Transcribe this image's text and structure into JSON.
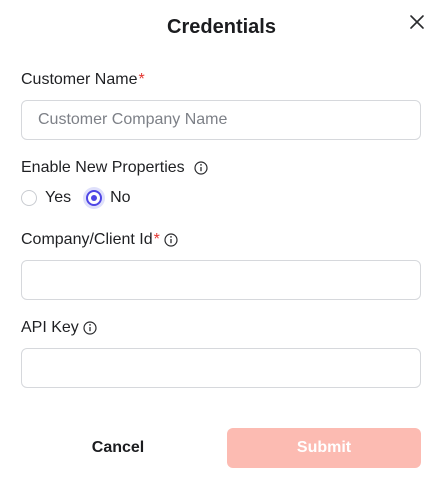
{
  "dialog": {
    "title": "Credentials"
  },
  "form": {
    "customer_name": {
      "label": "Customer Name",
      "required_mark": "*",
      "value": "",
      "placeholder": "Customer Company Name"
    },
    "enable_new_properties": {
      "label": "Enable New Properties",
      "options": [
        "Yes",
        "No"
      ],
      "selected": "No"
    },
    "company_client_id": {
      "label": "Company/Client Id",
      "required_mark": "*",
      "value": ""
    },
    "api_key": {
      "label": "API Key",
      "value": ""
    }
  },
  "actions": {
    "cancel_label": "Cancel",
    "submit_label": "Submit"
  },
  "colors": {
    "accent": "#4f46e5",
    "required": "#e3342f",
    "submit_disabled": "#fcbbb2"
  }
}
